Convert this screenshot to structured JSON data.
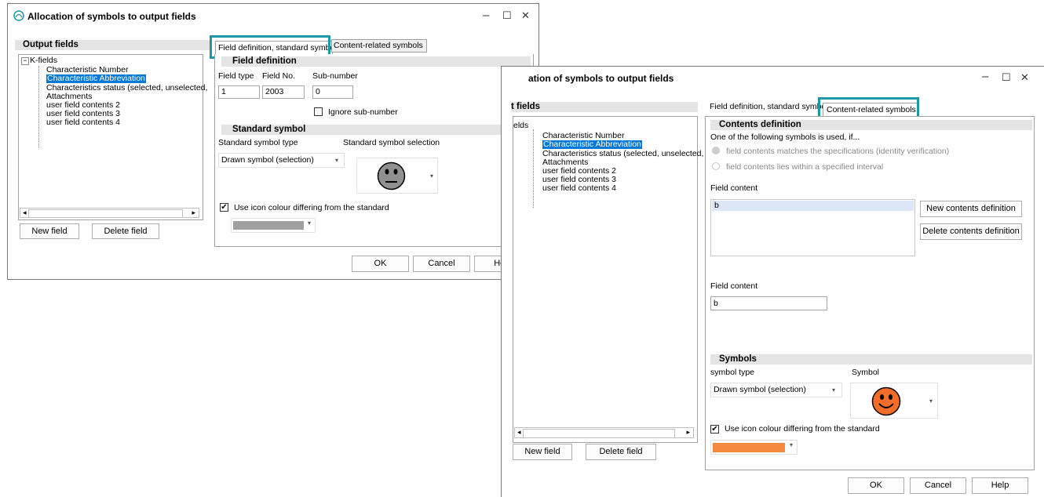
{
  "win1": {
    "title": "Allocation of symbols to output fields",
    "min_icon": "–",
    "max_icon": "☐",
    "close_icon": "✕",
    "output_fields_heading": "Output fields",
    "tree_root": "K-fields",
    "tree_items": [
      "Characteristic Number",
      "Characteristic Abbreviation",
      "Characteristics status (selected, unselected,",
      "Attachments",
      "user field contents 2",
      "user field contents 3",
      "user field contents 4"
    ],
    "scroll_left": "◂",
    "scroll_right": "▸",
    "new_field": "New field",
    "delete_field": "Delete field",
    "tab_field_def": "Field definition, standard symbol",
    "tab_content": "Content-related symbols",
    "field_definition_heading": "Field definition",
    "field_type_label": "Field type",
    "field_no_label": "Field No.",
    "sub_number_label": "Sub-number",
    "field_type_value": "1",
    "field_no_value": "2003",
    "sub_number_value": "0",
    "ignore_sub_number": "Ignore sub-number",
    "standard_symbol_heading": "Standard symbol",
    "standard_symbol_type_label": "Standard symbol type",
    "standard_symbol_selection_label": "Standard symbol selection",
    "symbol_type_value": "Drawn symbol (selection)",
    "use_icon_colour": "Use icon colour differing from the standard",
    "check_mark": "✔",
    "dropdown_arrow": "▾",
    "ok": "OK",
    "cancel": "Cancel",
    "help": "Help",
    "icon_colour": "#a0a0a0",
    "symbol_face_colour": "#909090"
  },
  "win2": {
    "title": "ation of symbols to output fields",
    "min_icon": "–",
    "max_icon": "☐",
    "close_icon": "✕",
    "output_fields_heading": "t fields",
    "tree_root": "elds",
    "tree_items": [
      "Characteristic Number",
      "Characteristic Abbreviation",
      "Characteristics status (selected, unselected,",
      "Attachments",
      "user field contents 2",
      "user field contents 3",
      "user field contents 4"
    ],
    "scroll_left": "◂",
    "scroll_right": "▸",
    "new_field": "New field",
    "delete_field": "Delete field",
    "tab_field_def": "Field definition, standard symbol",
    "tab_content": "Content-related symbols",
    "contents_definition_heading": "Contents definition",
    "one_of_following": "One of the following symbols is used, if...",
    "radio_identity": "field contents matches the specifications (identity verification)",
    "radio_interval": "field contents lies within a specified interval",
    "field_content_label1": "Field content",
    "field_content_list": [
      "b"
    ],
    "new_contents_definition": "New contents definition",
    "delete_contents_definition": "Delete contents definition",
    "field_content_label2": "Field content",
    "field_content_value": "b",
    "symbols_heading": "Symbols",
    "symbol_type_label": "symbol type",
    "symbol_label": "Symbol",
    "symbol_type_value": "Drawn symbol (selection)",
    "use_icon_colour": "Use icon colour differing from the standard",
    "check_mark": "✔",
    "dropdown_arrow": "▾",
    "ok": "OK",
    "cancel": "Cancel",
    "help": "Help",
    "icon_colour": "#f5893f",
    "symbol_face_colour": "#f36d2a",
    "highlight_colour": "#1a9aa6"
  }
}
